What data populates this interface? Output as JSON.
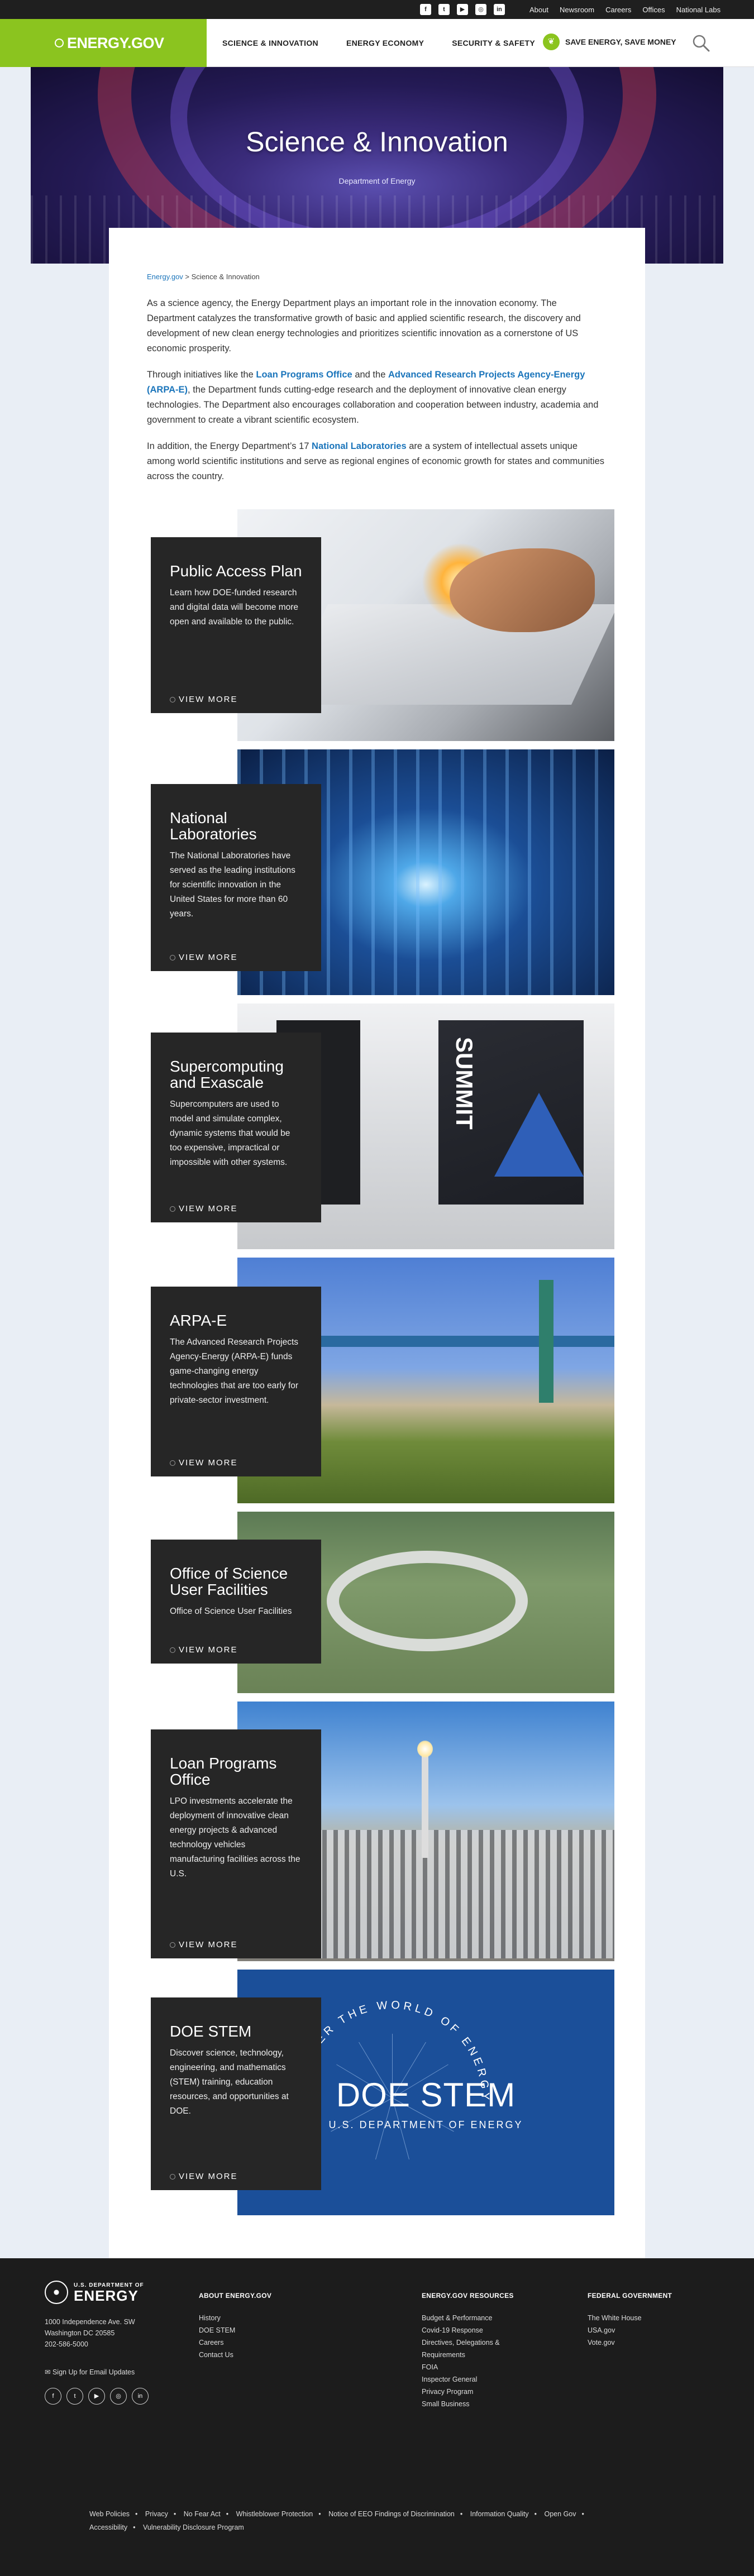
{
  "utility": {
    "social": [
      "f",
      "t",
      "▶",
      "◎",
      "in"
    ],
    "links": [
      "About",
      "Newsroom",
      "Careers",
      "Offices",
      "National Labs"
    ]
  },
  "nav": {
    "logo": "ENERGY.GOV",
    "menu": [
      "SCIENCE & INNOVATION",
      "ENERGY ECONOMY",
      "SECURITY & SAFETY"
    ],
    "save": "SAVE ENERGY, SAVE MONEY"
  },
  "hero": {
    "title": "Science & Innovation",
    "subtitle": "Department of Energy"
  },
  "breadcrumb": {
    "home": "Energy.gov",
    "separator": ">",
    "current": "Science & Innovation"
  },
  "intro": {
    "p1": "As a science agency, the Energy Department plays an important role in the innovation economy. The Department catalyzes the transformative growth of basic and applied scientific research, the discovery and development of new clean energy technologies and prioritizes scientific innovation as a cornerstone of US economic prosperity.",
    "p2_a": "Through initiatives like the ",
    "p2_link1": "Loan Programs Office",
    "p2_b": " and the ",
    "p2_link2": "Advanced Research Projects Agency-Energy (ARPA-E)",
    "p2_c": ", the Department funds cutting-edge research and the deployment of innovative clean energy technologies. The Department also encourages collaboration and cooperation between industry, academia and government to create a vibrant scientific ecosystem.",
    "p3_a": "In addition, the Energy Department’s 17 ",
    "p3_link": "National Laboratories",
    "p3_b": " are a system of intellectual assets unique among world scientific institutions and serve as regional engines of economic growth for states and communities across the country."
  },
  "features": [
    {
      "title": "Public Access Plan",
      "text": "Learn how DOE-funded research and digital data will become more open and available to the public.",
      "more": "VIEW MORE"
    },
    {
      "title": "National Laboratories",
      "text": "The National Laboratories have served as the leading institutions for scientific innovation in the United States for more than 60 years.",
      "more": "VIEW MORE"
    },
    {
      "title": "Supercomputing and Exascale",
      "text": "Supercomputers are used to model and simulate complex, dynamic systems that would be too expensive, impractical or impossible with other systems.",
      "more": "VIEW MORE"
    },
    {
      "title": "ARPA-E",
      "text": "The Advanced Research Projects Agency-Energy (ARPA-E) funds game-changing energy technologies that are too early for private-sector investment.",
      "more": "VIEW MORE"
    },
    {
      "title": "Office of Science User Facilities",
      "text": "Office of Science User Facilities",
      "more": "VIEW MORE"
    },
    {
      "title": "Loan Programs Office",
      "text": "LPO investments accelerate the deployment of innovative clean energy projects & advanced technology vehicles manufacturing facilities across the U.S.",
      "more": "VIEW MORE"
    },
    {
      "title": "DOE STEM",
      "text": "Discover science, technology, engineering, and mathematics (STEM) training, education resources, and opportunities at DOE.",
      "more": "VIEW MORE"
    }
  ],
  "images": {
    "summit_label": "SUMMIT",
    "stem_title": "DOE STEM",
    "stem_sub": "U.S. DEPARTMENT OF ENERGY",
    "stem_arc": "DISCOVER THE WORLD OF ENERGY"
  },
  "footer": {
    "logo_top": "U.S. DEPARTMENT OF",
    "logo_main": "ENERGY",
    "address": [
      "1000 Independence Ave. SW",
      "Washington DC 20585",
      "202-586-5000"
    ],
    "signup": "Sign Up for Email Updates",
    "social": [
      "f",
      "t",
      "▶",
      "◎",
      "in"
    ],
    "about": {
      "heading": "ABOUT ENERGY.GOV",
      "links": [
        "History",
        "DOE STEM",
        "Careers",
        "Contact Us"
      ]
    },
    "resources": {
      "heading": "ENERGY.GOV RESOURCES",
      "links": [
        "Budget & Performance",
        "Covid-19 Response",
        "Directives, Delegations & Requirements",
        "FOIA",
        "Inspector General",
        "Privacy Program",
        "Small Business"
      ]
    },
    "federal": {
      "heading": "FEDERAL GOVERNMENT",
      "links": [
        "The White House",
        "USA.gov",
        "Vote.gov"
      ]
    },
    "legal": [
      "Web Policies",
      "Privacy",
      "No Fear Act",
      "Whistleblower Protection",
      "Notice of EEO Findings of Discrimination",
      "Information Quality",
      "Open Gov",
      "Accessibility",
      "Vulnerability Disclosure Program"
    ]
  },
  "colors": {
    "brand_green": "#8bc41f",
    "link_blue": "#1b75bb",
    "box_dark": "#262626",
    "footer_bg": "#1c1c1c"
  }
}
